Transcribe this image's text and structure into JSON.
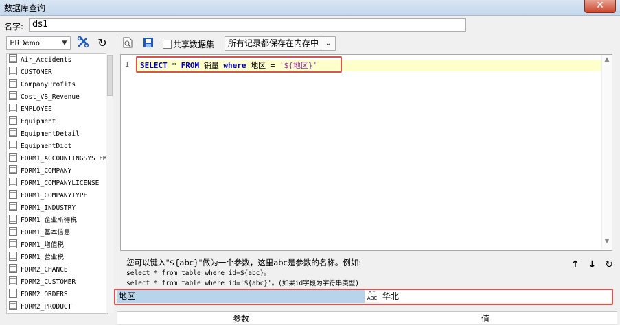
{
  "window": {
    "title": "数据库查询",
    "close_label": "✕"
  },
  "name_bar": {
    "label": "名字:",
    "value": "ds1"
  },
  "left_panel": {
    "connection": "FRDemo",
    "tables": [
      "Air_Accidents",
      "CUSTOMER",
      "CompanyProfits",
      "Cost_VS_Revenue",
      "EMPLOYEE",
      "Equipment",
      "EquipmentDetail",
      "EquipmentDict",
      "FORM1_ACCOUNTINGSYSTEM",
      "FORM1_COMPANY",
      "FORM1_COMPANYLICENSE",
      "FORM1_COMPANYTYPE",
      "FORM1_INDUSTRY",
      "FORM1_企业所得税",
      "FORM1_基本信息",
      "FORM1_增值税",
      "FORM1_营业税",
      "FORM2_CHANCE",
      "FORM2_CUSTOMER",
      "FORM2_ORDERS",
      "FORM2_PRODUCT"
    ]
  },
  "toolbar": {
    "shared_dataset_label": "共享数据集",
    "memory_option": "所有记录都保存在内存中"
  },
  "editor": {
    "line_number": "1",
    "sql": {
      "kw_select": "SELECT",
      "star": " * ",
      "kw_from": "FROM",
      "table": " 销量 ",
      "kw_where": "where",
      "cond": " 地区 = ",
      "param": "'${地区}'"
    }
  },
  "hint": {
    "line1": "您可以键入\"${abc}\"做为一个参数，这里abc是参数的名称。例如:",
    "line2": "select * from table where id=${abc}。",
    "line3": "select * from table where id='${abc}'。(如果id字段为字符串类型)"
  },
  "params": {
    "col_name": "参数",
    "col_value": "值",
    "rows": [
      {
        "name": "地区",
        "type_icon": "A↓ ABC",
        "value": "华北"
      }
    ]
  }
}
